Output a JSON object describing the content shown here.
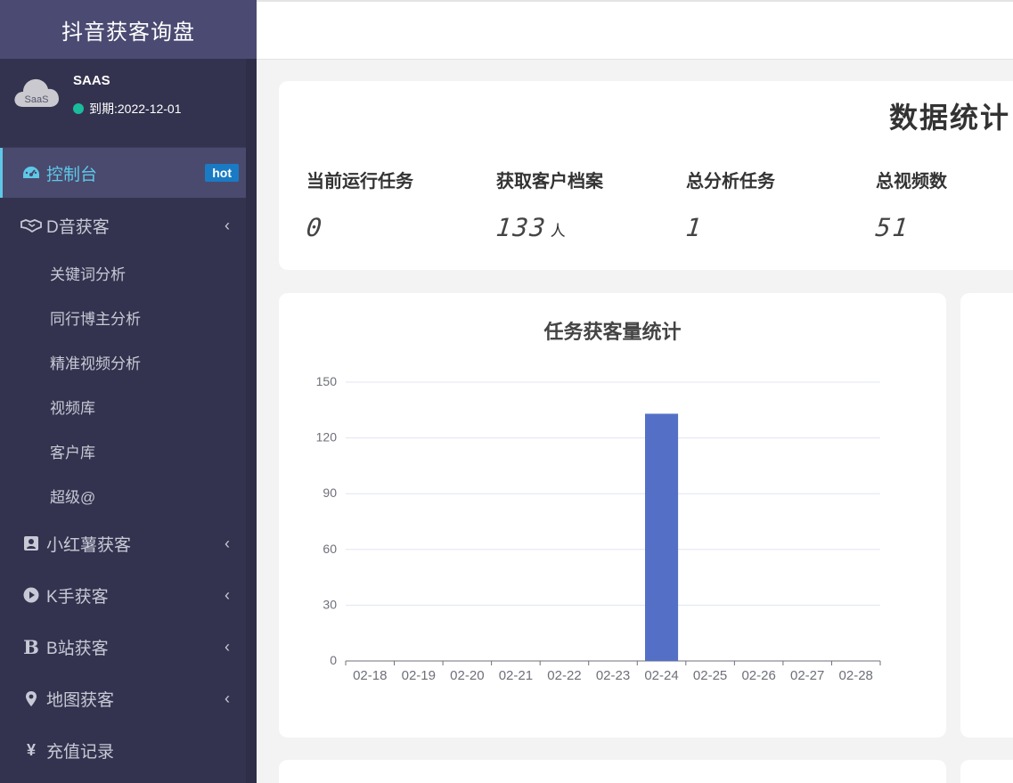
{
  "brand": {
    "title": "抖音获客询盘"
  },
  "user": {
    "avatar_text": "SaaS",
    "name": "SAAS",
    "expire": "到期:2022-12-01"
  },
  "sidebar": {
    "items": [
      {
        "label": "控制台",
        "icon": "dashboard-icon",
        "badge": "hot",
        "active": true
      },
      {
        "label": "D音获客",
        "icon": "handshake-icon",
        "chevron": "‹",
        "children": [
          "关键词分析",
          "同行博主分析",
          "精准视频分析",
          "视频库",
          "客户库",
          "超级@"
        ]
      },
      {
        "label": "小红薯获客",
        "icon": "contact-card-icon",
        "chevron": "‹"
      },
      {
        "label": "K手获客",
        "icon": "play-circle-icon",
        "chevron": "‹"
      },
      {
        "label": "B站获客",
        "icon": "bold-b-icon",
        "icon_text": "B",
        "chevron": "‹"
      },
      {
        "label": "地图获客",
        "icon": "map-marker-icon",
        "chevron": "‹"
      },
      {
        "label": "充值记录",
        "icon": "yen-icon",
        "icon_text": "¥"
      }
    ]
  },
  "stats": {
    "title": "数据统计",
    "items": [
      {
        "label": "当前运行任务",
        "value": "0",
        "unit": ""
      },
      {
        "label": "获取客户档案",
        "value": "133",
        "unit": "人"
      },
      {
        "label": "总分析任务",
        "value": "1",
        "unit": ""
      },
      {
        "label": "总视频数",
        "value": "51",
        "unit": ""
      }
    ]
  },
  "chart_data": {
    "type": "bar",
    "title": "任务获客量统计",
    "categories": [
      "02-18",
      "02-19",
      "02-20",
      "02-21",
      "02-22",
      "02-23",
      "02-24",
      "02-25",
      "02-26",
      "02-27",
      "02-28"
    ],
    "values": [
      0,
      0,
      0,
      0,
      0,
      0,
      133,
      0,
      0,
      0,
      0
    ],
    "ylim": [
      0,
      150
    ],
    "yticks": [
      0,
      30,
      60,
      90,
      120,
      150
    ],
    "xlabel": "",
    "ylabel": "",
    "grid": true,
    "bar_color": "#5470c6"
  },
  "colors": {
    "sidebar_bg": "#33334f",
    "brand_bg": "#4a4a72",
    "active_accent": "#5ec8e8",
    "hot_badge": "#1a7bc4",
    "status_dot": "#1abc9c"
  }
}
